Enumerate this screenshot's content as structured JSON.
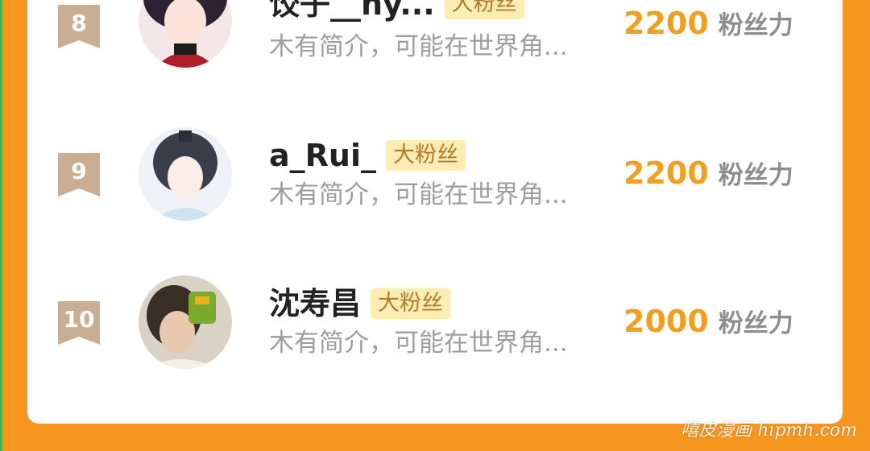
{
  "ranking": {
    "items": [
      {
        "rank": "8",
        "username": "饺子__hy...",
        "tag": "大粉丝",
        "bio": "木有简介，可能在世界角...",
        "score": "2200",
        "score_unit": "粉丝力"
      },
      {
        "rank": "9",
        "username": "a_Rui_",
        "tag": "大粉丝",
        "bio": "木有简介，可能在世界角...",
        "score": "2200",
        "score_unit": "粉丝力"
      },
      {
        "rank": "10",
        "username": "沈寿昌",
        "tag": "大粉丝",
        "bio": "木有简介，可能在世界角...",
        "score": "2000",
        "score_unit": "粉丝力"
      }
    ]
  },
  "watermark": "嘻皮漫画 hipmh.com",
  "colors": {
    "background": "#F7961E",
    "card": "#FFFFFF",
    "score": "#F0A020",
    "tag_bg": "#FDEDB3",
    "rank_badge": "#C9AE94"
  }
}
